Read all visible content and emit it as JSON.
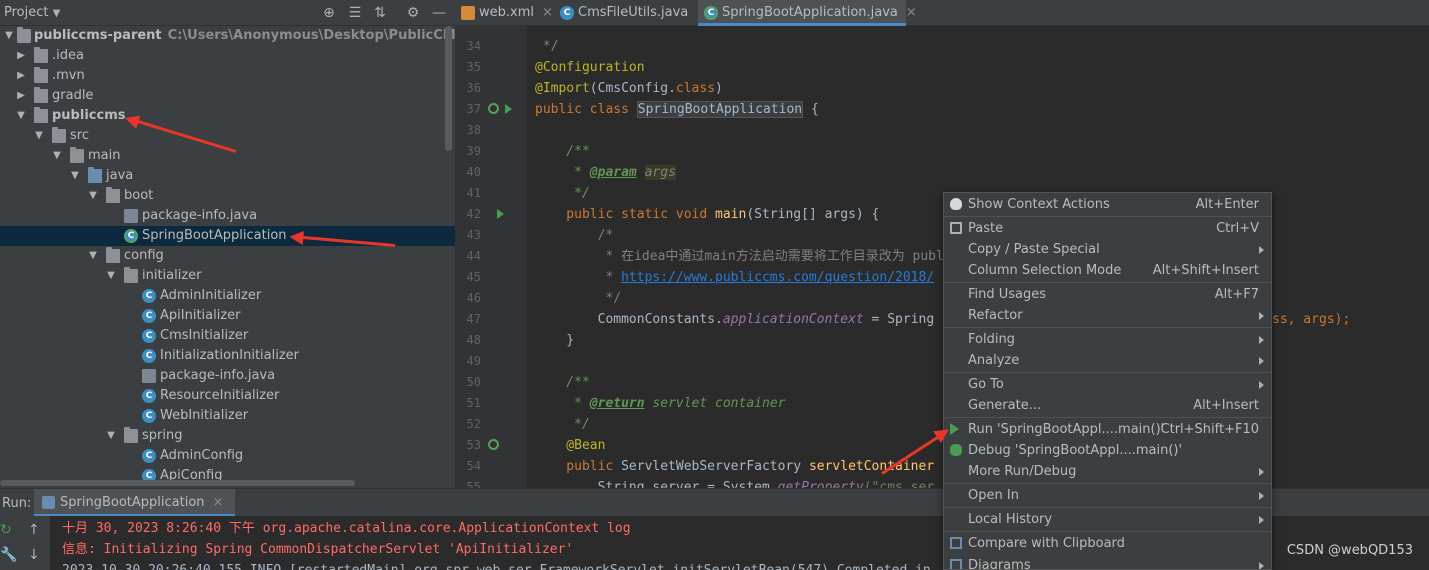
{
  "project_panel": {
    "title": "Project",
    "tree": [
      {
        "label": "publiccms-parent",
        "path": "C:\\Users\\Anonymous\\Desktop\\PublicCMS-master\\pu",
        "bold": true
      },
      {
        "label": ".idea"
      },
      {
        "label": ".mvn"
      },
      {
        "label": "gradle"
      },
      {
        "label": "publiccms",
        "bold": true
      },
      {
        "label": "src"
      },
      {
        "label": "main"
      },
      {
        "label": "java"
      },
      {
        "label": "boot"
      },
      {
        "label": "package-info.java"
      },
      {
        "label": "SpringBootApplication"
      },
      {
        "label": "config"
      },
      {
        "label": "initializer"
      },
      {
        "label": "AdminInitializer"
      },
      {
        "label": "ApiInitializer"
      },
      {
        "label": "CmsInitializer"
      },
      {
        "label": "InitializationInitializer"
      },
      {
        "label": "package-info.java"
      },
      {
        "label": "ResourceInitializer"
      },
      {
        "label": "WebInitializer"
      },
      {
        "label": "spring"
      },
      {
        "label": "AdminConfig"
      },
      {
        "label": "ApiConfig"
      }
    ]
  },
  "editor": {
    "tabs": [
      {
        "label": "web.xml"
      },
      {
        "label": "CmsFileUtils.java"
      },
      {
        "label": "SpringBootApplication.java"
      }
    ],
    "line_numbers": [
      "34",
      "35",
      "36",
      "37",
      "38",
      "39",
      "40",
      "41",
      "42",
      "43",
      "44",
      "45",
      "46",
      "47",
      "48",
      "49",
      "50",
      "51",
      "52",
      "53",
      "54",
      "55"
    ],
    "code": {
      "l34": " */",
      "l35": "@Configuration",
      "l36a": "@Import",
      "l36b": "(CmsConfig.",
      "l36c": "class",
      "l36d": ")",
      "l37a": "public class ",
      "l37b": "SpringBootApplication",
      "l37c": " {",
      "l39": "    /**",
      "l40a": "     * ",
      "l40b": "@param",
      "l40c": " ",
      "l40d": "args",
      "l41": "     */",
      "l42a": "    public static void ",
      "l42b": "main",
      "l42c": "(String[] args) {",
      "l43": "        /*",
      "l44": "         * 在idea中通过main方法启动需要将工作目录改为 publ",
      "l45a": "         * ",
      "l45b": "https://www.publiccms.com/question/2018/",
      "l46": "         */",
      "l47a": "        CommonConstants.",
      "l47b": "applicationContext",
      "l47c": " = Spring",
      "l47d": "ss, args);",
      "l48": "    }",
      "l50": "    /**",
      "l51a": "     * ",
      "l51b": "@return",
      "l51c": " servlet container",
      "l52": "     */",
      "l53": "    @Bean",
      "l54a": "    public ",
      "l54b": "ServletWebServerFactory ",
      "l54c": "servletContainer",
      "l55a": "        String server = System.",
      "l55b": "getProperty",
      "l55c": "(\"cms.ser"
    }
  },
  "run_panel": {
    "label": "Run:",
    "tab": "SpringBootApplication",
    "console": [
      "十月 30, 2023 8:26:40 下午 org.apache.catalina.core.ApplicationContext log",
      "信息: Initializing Spring CommonDispatcherServlet 'ApiInitializer'",
      "2023-10-30 20:26:40.155 INFO [restartedMain] org.spr.web.ser.FrameworkServlet.initServletBean(547) Completed in"
    ]
  },
  "context_menu": {
    "items": [
      {
        "label": "Show Context Actions",
        "shortcut": "Alt+Enter"
      },
      {
        "label": "Paste",
        "shortcut": "Ctrl+V"
      },
      {
        "label": "Copy / Paste Special",
        "shortcut": ""
      },
      {
        "label": "Column Selection Mode",
        "shortcut": "Alt+Shift+Insert"
      },
      {
        "label": "Find Usages",
        "shortcut": "Alt+F7"
      },
      {
        "label": "Refactor",
        "shortcut": ""
      },
      {
        "label": "Folding",
        "shortcut": ""
      },
      {
        "label": "Analyze",
        "shortcut": ""
      },
      {
        "label": "Go To",
        "shortcut": ""
      },
      {
        "label": "Generate...",
        "shortcut": "Alt+Insert"
      },
      {
        "label": "Run 'SpringBootAppl....main()'",
        "shortcut": "Ctrl+Shift+F10"
      },
      {
        "label": "Debug 'SpringBootAppl....main()'",
        "shortcut": ""
      },
      {
        "label": "More Run/Debug",
        "shortcut": ""
      },
      {
        "label": "Open In",
        "shortcut": ""
      },
      {
        "label": "Local History",
        "shortcut": ""
      },
      {
        "label": "Compare with Clipboard",
        "shortcut": ""
      },
      {
        "label": "Diagrams",
        "shortcut": ""
      }
    ]
  },
  "watermark": "CSDN @webQD153",
  "colors": {
    "accent": "#4a88c7",
    "annotation_arrow": "#e8372a",
    "run_green": "#499c54",
    "error_text": "#ff6b68"
  }
}
